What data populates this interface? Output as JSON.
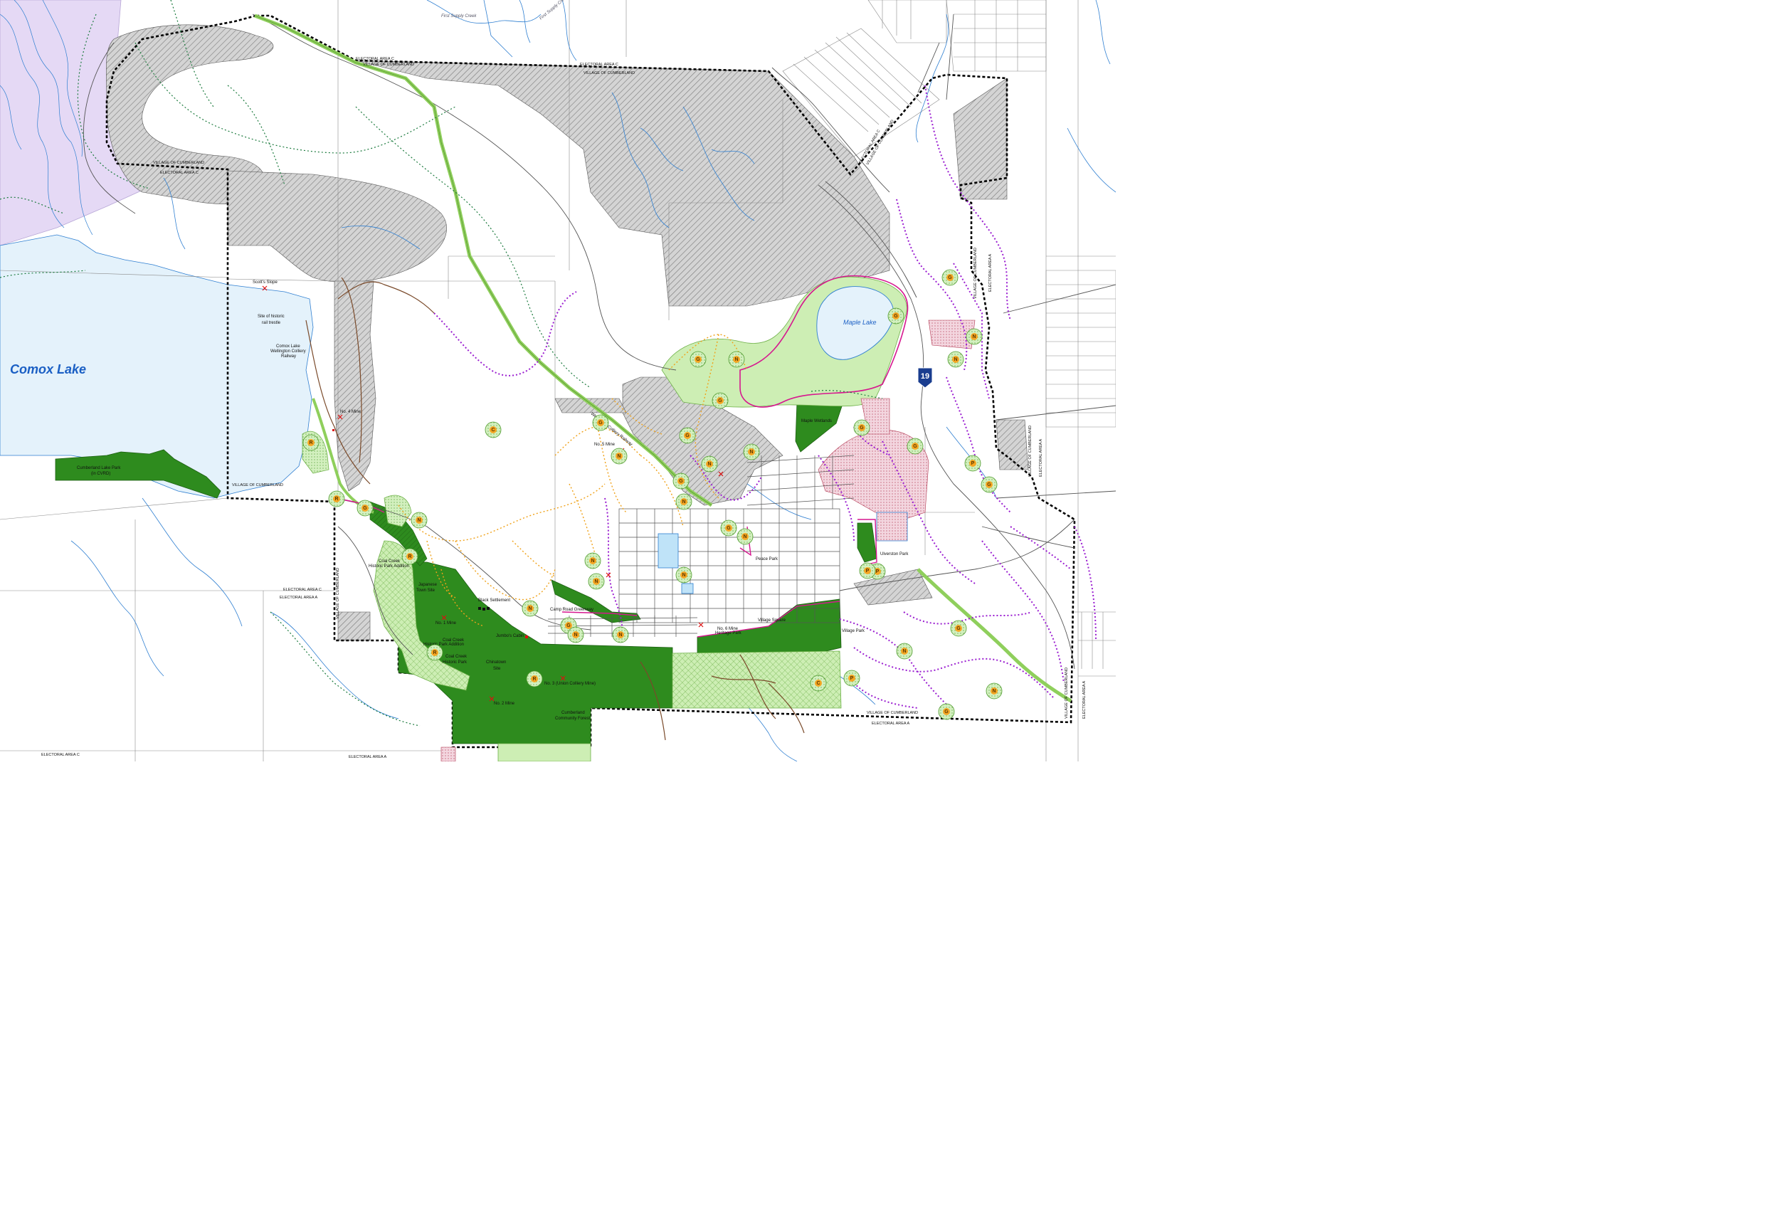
{
  "map": {
    "water_labels": {
      "comox_lake": "Comox Lake",
      "maple_lake": "Maple Lake",
      "first_supply_creek_1": "First Supply Creek",
      "first_supply_creek_2": "First Supply Creek"
    },
    "boundary_labels": [
      {
        "id": "ea-c-top",
        "text": "ELECTORAL AREA C"
      },
      {
        "id": "voc-top-1",
        "text": "VILLAGE OF CUMBERLAND"
      },
      {
        "id": "ea-c-top-2",
        "text": "ELECTORAL AREA C"
      },
      {
        "id": "voc-top-2",
        "text": "VILLAGE OF CUMBERLAND"
      },
      {
        "id": "voc-left",
        "text": "VILLAGE OF CUMBERLAND"
      },
      {
        "id": "ea-c-left",
        "text": "ELECTORAL AREA C"
      },
      {
        "id": "voc-lake",
        "text": "VILLAGE OF CUMBERLAND"
      },
      {
        "id": "ea-c-mid",
        "text": "ELECTORAL AREA C"
      },
      {
        "id": "ea-a-mid",
        "text": "ELECTORAL AREA A"
      },
      {
        "id": "voc-vert",
        "text": "VILLAGE OF CUMBERLAND"
      },
      {
        "id": "ea-c-ne",
        "text": "ELECTORAL AREA C"
      },
      {
        "id": "voc-ne",
        "text": "VILLAGE OF CUMBERLAND"
      },
      {
        "id": "ea-a-right-1",
        "text": "ELECTORAL AREA A"
      },
      {
        "id": "voc-right-1",
        "text": "VILLAGE OF CUMBERLAND"
      },
      {
        "id": "voc-right-2",
        "text": "VILLAGE OF CUMBERLAND"
      },
      {
        "id": "ea-a-right-2",
        "text": "ELECTORAL AREA A"
      },
      {
        "id": "voc-bottom",
        "text": "VILLAGE OF CUMBERLAND"
      },
      {
        "id": "ea-a-bottom",
        "text": "ELECTORAL AREA A"
      },
      {
        "id": "ea-c-bottom",
        "text": "ELECTORAL AREA C"
      },
      {
        "id": "ea-a-bottom-2",
        "text": "ELECTORAL AREA A"
      },
      {
        "id": "voc-se",
        "text": "VILLAGE OF CUMBERLAND"
      },
      {
        "id": "ea-a-se",
        "text": "ELECTORAL AREA A"
      }
    ],
    "place_labels": {
      "scotts_slope": "Scott's Slope",
      "rail_trestle_1": "Site of historic",
      "rail_trestle_2": "rail trestle",
      "wellington_rail_1": "Comox Lake",
      "wellington_rail_2": "Wellington Colliery",
      "wellington_rail_3": "Railway",
      "no4_mine": "No. 4 Mine",
      "cumberland_lake_park_1": "Cumberland Lake Park",
      "cumberland_lake_park_2": "(in CVRD)",
      "coal_creek_addition_1": "Coal Creek",
      "coal_creek_addition_2": "Historic Park Addition",
      "japanese_town_1": "Japanese",
      "japanese_town_2": "Town Site",
      "black_settlement": "Black Settlement",
      "no1_mine": "No. 1 Mine",
      "jumbos_cabin": "Jumbo's Cabin",
      "coal_creek_addition_b1": "Coal Creek",
      "coal_creek_addition_b2": "Historic Park Addition",
      "coal_creek_park_1": "Coal Creek",
      "coal_creek_park_2": "Historic Park",
      "chinatown_1": "Chinatown",
      "chinatown_2": "Site",
      "no2_mine": "No. 2 Mine",
      "no3_mine": "No. 3 (Union Colliery Mine)",
      "community_forest_1": "Cumberland",
      "community_forest_2": "Community Forest",
      "camp_road_greenway": "Camp Road Greenway",
      "no5_mine": "No. 5 Mine",
      "wellington_railway_diag": "Wellington Colliery Railway",
      "maple_wetlands": "Maple Wetlands",
      "peace_park": "Peace Park",
      "ulverston_park": "Ulverston Park",
      "village_park": "Village Park",
      "no6_mine_1": "No. 6 Mine",
      "no6_mine_2": "Heritage Park",
      "village_square": "Village Square",
      "highway_shield": "19"
    },
    "markers": [
      {
        "letter": "C"
      },
      {
        "letter": "R"
      },
      {
        "letter": "R"
      },
      {
        "letter": "G"
      },
      {
        "letter": "N"
      },
      {
        "letter": "R"
      },
      {
        "letter": "R"
      },
      {
        "letter": "N"
      },
      {
        "letter": "N"
      },
      {
        "letter": "G"
      },
      {
        "letter": "N"
      },
      {
        "letter": "N"
      },
      {
        "letter": "N"
      },
      {
        "letter": "G"
      },
      {
        "letter": "N"
      },
      {
        "letter": "G"
      },
      {
        "letter": "N"
      },
      {
        "letter": "N"
      },
      {
        "letter": "G"
      },
      {
        "letter": "N"
      },
      {
        "letter": "G"
      },
      {
        "letter": "N"
      },
      {
        "letter": "G"
      },
      {
        "letter": "N"
      },
      {
        "letter": "N"
      },
      {
        "letter": "G"
      },
      {
        "letter": "P"
      },
      {
        "letter": "G"
      },
      {
        "letter": "P"
      },
      {
        "letter": "G"
      },
      {
        "letter": "R"
      },
      {
        "letter": "G"
      },
      {
        "letter": "G"
      },
      {
        "letter": "N"
      },
      {
        "letter": "G"
      },
      {
        "letter": "P"
      },
      {
        "letter": "N"
      },
      {
        "letter": "P"
      },
      {
        "letter": "C"
      },
      {
        "letter": "N"
      },
      {
        "letter": "G"
      },
      {
        "letter": "G"
      },
      {
        "letter": "N"
      }
    ],
    "colors": {
      "water": "#e4f2fb",
      "water_outline": "#2f7fd1",
      "crown_land": "#e5d9f5",
      "dark_park": "#2e8b1e",
      "light_park": "#cdeeb4",
      "hatched_zone": "#c9c9c9",
      "village_boundary": "#000000",
      "purple_trail": "#9b1fd1",
      "orange_trail": "#f0a21a",
      "green_trail": "#1b7a3d",
      "brown_trail": "#7a4a2a",
      "rail_green": "#8fcf5c",
      "marker_fill": "#f5a623",
      "marker_ring": "#8fd16a",
      "magenta_outline": "#d6178f"
    }
  }
}
